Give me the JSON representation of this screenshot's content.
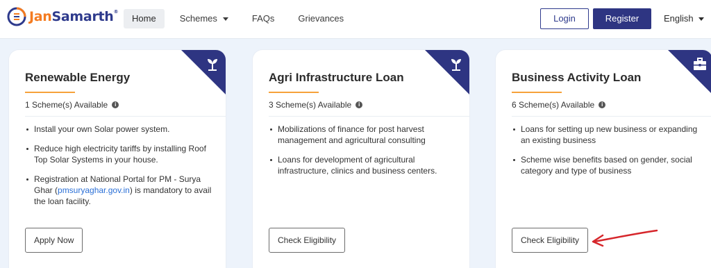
{
  "header": {
    "logo": {
      "jan": "Jan",
      "samarth": "Samarth",
      "mark": "®"
    },
    "nav": [
      {
        "label": "Home",
        "active": true
      },
      {
        "label": "Schemes",
        "has_dropdown": true
      },
      {
        "label": "FAQs"
      },
      {
        "label": "Grievances"
      }
    ],
    "login_label": "Login",
    "register_label": "Register",
    "language": "English"
  },
  "cards": [
    {
      "title": "Renewable Energy",
      "icon": "sprout-icon",
      "count": "1 Scheme(s) Available",
      "bullets": [
        "Install your own Solar power system.",
        "Reduce high electricity tariffs by installing Roof Top Solar Systems in your house."
      ],
      "bullet3_pre": "Registration at National Portal for PM - Surya Ghar (",
      "bullet3_link": "pmsuryaghar.gov.in",
      "bullet3_post": ") is mandatory to avail the loan facility.",
      "button": "Apply Now"
    },
    {
      "title": "Agri Infrastructure Loan",
      "icon": "sprout-icon",
      "count": "3 Scheme(s) Available",
      "bullets": [
        "Mobilizations of finance for post harvest management and agricultural consulting",
        "Loans for development of agricultural infrastructure, clinics and business centers."
      ],
      "button": "Check Eligibility"
    },
    {
      "title": "Business Activity Loan",
      "icon": "briefcase-icon",
      "count": "6 Scheme(s) Available",
      "bullets": [
        "Loans for setting up new business or expanding an existing business",
        "Scheme wise benefits based on gender, social category and type of business"
      ],
      "button": "Check Eligibility"
    }
  ],
  "colors": {
    "brand_navy": "#2e3582",
    "brand_orange": "#f47b20",
    "underline": "#f6a13a",
    "arrow": "#d6262b",
    "background": "#edf3fb"
  }
}
